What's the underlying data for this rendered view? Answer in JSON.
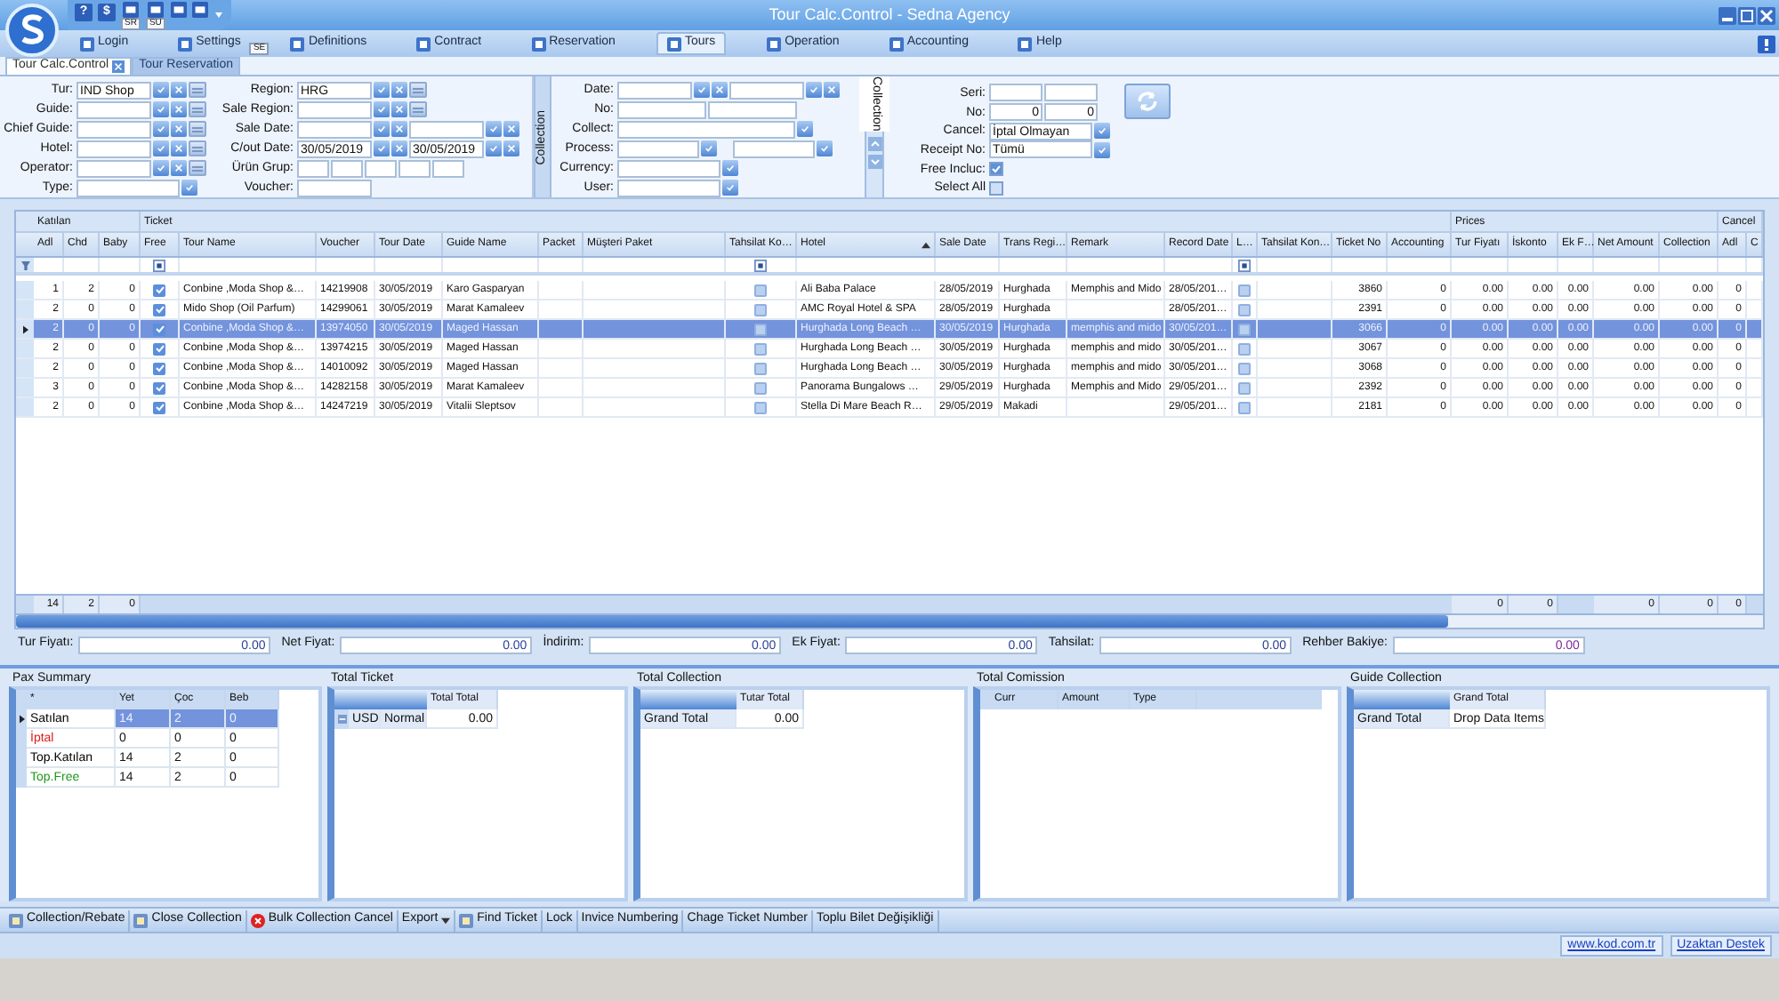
{
  "window": {
    "title": "Tour Calc.Control - Sedna Agency"
  },
  "quick_access": [
    {
      "kind": "glyph",
      "glyph": "?"
    },
    {
      "kind": "glyph",
      "glyph": "$"
    },
    {
      "kind": "icon",
      "badge": "SR"
    },
    {
      "kind": "icon",
      "badge": "SU"
    },
    {
      "kind": "icon"
    },
    {
      "kind": "icon"
    }
  ],
  "menu": [
    {
      "label": "Login",
      "selected": false
    },
    {
      "label": "Settings",
      "selected": false,
      "badge": "SE"
    },
    {
      "label": "Definitions",
      "selected": false
    },
    {
      "label": "Contract",
      "selected": false
    },
    {
      "label": "Reservation",
      "selected": false
    },
    {
      "label": "Tours",
      "selected": true
    },
    {
      "label": "Operation",
      "selected": false
    },
    {
      "label": "Accounting",
      "selected": false
    },
    {
      "label": "Help",
      "selected": false
    }
  ],
  "tabs": [
    {
      "label": "Tour Calc.Control",
      "selected": true
    },
    {
      "label": "Tour Reservation",
      "selected": false
    }
  ],
  "filters": {
    "left": [
      {
        "label": "Tur:",
        "kind": "lookup",
        "value": "IND Shop"
      },
      {
        "label": "Guide:",
        "kind": "lookup"
      },
      {
        "label": "Chief Guide:",
        "kind": "lookup"
      },
      {
        "label": "Hotel:",
        "kind": "lookup"
      },
      {
        "label": "Operator:",
        "kind": "lookup"
      },
      {
        "label": "Type:",
        "kind": "combo"
      }
    ],
    "middle": [
      {
        "label": "Region:",
        "kind": "lookup",
        "value": "HRG"
      },
      {
        "label": "Sale Region:",
        "kind": "lookup"
      },
      {
        "label": "Sale Date:",
        "kind": "date_range"
      },
      {
        "label": "C/out Date:",
        "kind": "date_range",
        "values": [
          "30/05/2019",
          "30/05/2019"
        ]
      },
      {
        "label": "Ürün Grup:",
        "kind": "boxes"
      },
      {
        "label": "Voucher:",
        "kind": "text"
      }
    ],
    "collection_tab": "Collection",
    "collection": [
      {
        "label": "Date:",
        "kind": "date_range"
      },
      {
        "label": "No:",
        "kind": "pair"
      },
      {
        "label": "Collect:",
        "kind": "combo_wide"
      },
      {
        "label": "Process:",
        "kind": "combo_pair"
      },
      {
        "label": "Currency:",
        "kind": "combo"
      },
      {
        "label": "User:",
        "kind": "combo"
      }
    ],
    "side_tab": "Collection",
    "receipt": [
      {
        "label": "Seri:",
        "kind": "pair_small"
      },
      {
        "label": "No:",
        "kind": "pair_small",
        "values": [
          "0",
          "0"
        ]
      },
      {
        "label": "Cancel:",
        "kind": "combo",
        "value": "İptal Olmayan"
      },
      {
        "label": "Receipt No:",
        "kind": "combo",
        "value": "Tümü"
      },
      {
        "label": "Free Incluc:",
        "kind": "check",
        "checked": true
      },
      {
        "label": "Select All",
        "kind": "check",
        "checked": false
      }
    ]
  },
  "grid": {
    "bands": [
      {
        "label": "Katılan"
      },
      {
        "label": "Ticket"
      },
      {
        "label": "Prices"
      },
      {
        "label": "Cancel"
      }
    ],
    "columns": [
      {
        "label": "Adl",
        "kind": "num"
      },
      {
        "label": "Chd",
        "kind": "num"
      },
      {
        "label": "Baby",
        "kind": "num"
      },
      {
        "label": "Free",
        "kind": "check"
      },
      {
        "label": "Tour Name",
        "kind": "text"
      },
      {
        "label": "Voucher",
        "kind": "text"
      },
      {
        "label": "Tour Date",
        "kind": "text"
      },
      {
        "label": "Guide Name",
        "kind": "text"
      },
      {
        "label": "Packet",
        "kind": "text"
      },
      {
        "label": "Müşteri Paket",
        "kind": "text"
      },
      {
        "label": "Tahsilat Ko…",
        "kind": "check"
      },
      {
        "label": "Hotel",
        "kind": "text",
        "sorted": true
      },
      {
        "label": "Sale Date",
        "kind": "text"
      },
      {
        "label": "Trans Regi…",
        "kind": "text"
      },
      {
        "label": "Remark",
        "kind": "text"
      },
      {
        "label": "Record Date",
        "kind": "text"
      },
      {
        "label": "L…",
        "kind": "check"
      },
      {
        "label": "Tahsilat Kon…",
        "kind": "text"
      },
      {
        "label": "Ticket No",
        "kind": "num"
      },
      {
        "label": "Accounting",
        "kind": "num"
      },
      {
        "label": "Tur Fiyatı",
        "kind": "num"
      },
      {
        "label": "İskonto",
        "kind": "num"
      },
      {
        "label": "Ek F…",
        "kind": "num"
      },
      {
        "label": "Net Amount",
        "kind": "num"
      },
      {
        "label": "Collection",
        "kind": "num"
      },
      {
        "label": "Adl",
        "kind": "num"
      },
      {
        "label": "C",
        "kind": "num"
      }
    ],
    "rows": [
      {
        "selected": false,
        "adl": "1",
        "chd": "2",
        "baby": "0",
        "free": true,
        "tour_name": "Conbine ,Moda Shop &…",
        "voucher": "14219908",
        "tour_date": "30/05/2019",
        "guide_name": "Karo Gasparyan",
        "tahsilat": false,
        "hotel": "Ali Baba Palace",
        "sale_date": "28/05/2019",
        "trans_region": "Hurghada",
        "remark": "Memphis and Mido",
        "record_date": "28/05/201…",
        "l": false,
        "ticket_no": "3860",
        "accounting": "0",
        "tur_fiyati": "0.00",
        "iskonto": "0.00",
        "ek_fiyat": "0.00",
        "net_amount": "0.00",
        "collection": "0.00",
        "cancel_adl": "0"
      },
      {
        "selected": false,
        "adl": "2",
        "chd": "0",
        "baby": "0",
        "free": true,
        "tour_name": "Mido Shop (Oil Parfum)",
        "voucher": "14299061",
        "tour_date": "30/05/2019",
        "guide_name": "Marat Kamaleev",
        "tahsilat": false,
        "hotel": "AMC Royal Hotel & SPA",
        "sale_date": "28/05/2019",
        "trans_region": "Hurghada",
        "record_date": "28/05/201…",
        "l": false,
        "ticket_no": "2391",
        "accounting": "0",
        "tur_fiyati": "0.00",
        "iskonto": "0.00",
        "ek_fiyat": "0.00",
        "net_amount": "0.00",
        "collection": "0.00",
        "cancel_adl": "0"
      },
      {
        "selected": true,
        "adl": "2",
        "chd": "0",
        "baby": "0",
        "free": true,
        "tour_name": "Conbine ,Moda Shop &…",
        "voucher": "13974050",
        "tour_date": "30/05/2019",
        "guide_name": "Maged Hassan",
        "tahsilat": false,
        "hotel": "Hurghada Long Beach …",
        "sale_date": "30/05/2019",
        "trans_region": "Hurghada",
        "remark": "memphis and mido",
        "record_date": "30/05/201…",
        "l": false,
        "ticket_no": "3066",
        "accounting": "0",
        "tur_fiyati": "0.00",
        "iskonto": "0.00",
        "ek_fiyat": "0.00",
        "net_amount": "0.00",
        "collection": "0.00",
        "cancel_adl": "0"
      },
      {
        "selected": false,
        "adl": "2",
        "chd": "0",
        "baby": "0",
        "free": true,
        "tour_name": "Conbine ,Moda Shop &…",
        "voucher": "13974215",
        "tour_date": "30/05/2019",
        "guide_name": "Maged Hassan",
        "tahsilat": false,
        "hotel": "Hurghada Long Beach …",
        "sale_date": "30/05/2019",
        "trans_region": "Hurghada",
        "remark": "memphis and mido",
        "record_date": "30/05/201…",
        "l": false,
        "ticket_no": "3067",
        "accounting": "0",
        "tur_fiyati": "0.00",
        "iskonto": "0.00",
        "ek_fiyat": "0.00",
        "net_amount": "0.00",
        "collection": "0.00",
        "cancel_adl": "0"
      },
      {
        "selected": false,
        "adl": "2",
        "chd": "0",
        "baby": "0",
        "free": true,
        "tour_name": "Conbine ,Moda Shop &…",
        "voucher": "14010092",
        "tour_date": "30/05/2019",
        "guide_name": "Maged Hassan",
        "tahsilat": false,
        "hotel": "Hurghada Long Beach …",
        "sale_date": "30/05/2019",
        "trans_region": "Hurghada",
        "remark": "memphis and mido",
        "record_date": "30/05/201…",
        "l": false,
        "ticket_no": "3068",
        "accounting": "0",
        "tur_fiyati": "0.00",
        "iskonto": "0.00",
        "ek_fiyat": "0.00",
        "net_amount": "0.00",
        "collection": "0.00",
        "cancel_adl": "0"
      },
      {
        "selected": false,
        "adl": "3",
        "chd": "0",
        "baby": "0",
        "free": true,
        "tour_name": "Conbine ,Moda Shop &…",
        "voucher": "14282158",
        "tour_date": "30/05/2019",
        "guide_name": "Marat Kamaleev",
        "tahsilat": false,
        "hotel": "Panorama Bungalows …",
        "sale_date": "29/05/2019",
        "trans_region": "Hurghada",
        "remark": "Memphis and Mido",
        "record_date": "29/05/201…",
        "l": false,
        "ticket_no": "2392",
        "accounting": "0",
        "tur_fiyati": "0.00",
        "iskonto": "0.00",
        "ek_fiyat": "0.00",
        "net_amount": "0.00",
        "collection": "0.00",
        "cancel_adl": "0"
      },
      {
        "selected": false,
        "adl": "2",
        "chd": "0",
        "baby": "0",
        "free": true,
        "tour_name": "Conbine ,Moda Shop &…",
        "voucher": "14247219",
        "tour_date": "30/05/2019",
        "guide_name": "Vitalii Sleptsov",
        "tahsilat": false,
        "hotel": "Stella Di Mare Beach R…",
        "sale_date": "29/05/2019",
        "trans_region": "Makadi",
        "record_date": "29/05/201…",
        "l": false,
        "ticket_no": "2181",
        "accounting": "0",
        "tur_fiyati": "0.00",
        "iskonto": "0.00",
        "ek_fiyat": "0.00",
        "net_amount": "0.00",
        "collection": "0.00",
        "cancel_adl": "0"
      }
    ],
    "footer": {
      "adl": "14",
      "chd": "2",
      "baby": "0",
      "tur_fiyati": "0",
      "iskonto": "0",
      "net_amount": "0",
      "collection": "0",
      "cancel_adl": "0"
    }
  },
  "summary": [
    {
      "label": "Tur Fiyatı:",
      "value": "0.00",
      "color": "#2b3f95"
    },
    {
      "label": "Net Fiyat:",
      "value": "0.00",
      "color": "#2b3f95"
    },
    {
      "label": "İndirim:",
      "value": "0.00",
      "color": "#2b3f95"
    },
    {
      "label": "Ek Fiyat:",
      "value": "0.00",
      "color": "#2b3f95"
    },
    {
      "label": "Tahsilat:",
      "value": "0.00",
      "color": "#2b3f95"
    },
    {
      "label": "Rehber Bakiye:",
      "value": "0.00",
      "color": "#7b2c9c"
    }
  ],
  "pax_summary": {
    "title": "Pax Summary",
    "columns": [
      "*",
      "Yet",
      "Çoc",
      "Beb"
    ],
    "rows": [
      {
        "label": "Satılan",
        "color": "#000000",
        "selected": true,
        "values": [
          "14",
          "2",
          "0"
        ]
      },
      {
        "label": "İptal",
        "color": "#e01b1b",
        "selected": false,
        "values": [
          "0",
          "0",
          "0"
        ]
      },
      {
        "label": "Top.Katılan",
        "color": "#000000",
        "selected": false,
        "values": [
          "14",
          "2",
          "0"
        ]
      },
      {
        "label": "Top.Free",
        "color": "#1e9a1e",
        "selected": false,
        "values": [
          "14",
          "2",
          "0"
        ]
      }
    ]
  },
  "total_ticket": {
    "title": "Total Ticket",
    "header": "Total Total",
    "row": [
      "USD",
      "Normal",
      "0.00"
    ]
  },
  "total_collection": {
    "title": "Total Collection",
    "header": "Tutar Total",
    "row": [
      "Grand Total",
      "0.00"
    ]
  },
  "total_comission": {
    "title": "Total Comission",
    "columns": [
      "Curr",
      "Amount",
      "Type"
    ]
  },
  "guide_collection": {
    "title": "Guide Collection",
    "header": "Grand Total",
    "row": [
      "Grand Total",
      "Drop Data Items"
    ]
  },
  "toolbar": [
    {
      "label": "Collection/Rebate",
      "kind": "icon"
    },
    {
      "label": "Close Collection",
      "kind": "icon"
    },
    {
      "label": "Bulk Collection Cancel",
      "kind": "cancel"
    },
    {
      "label": "Export",
      "kind": "menu"
    },
    {
      "label": "Find Ticket",
      "kind": "icon"
    },
    {
      "label": "Lock",
      "kind": "plain"
    },
    {
      "label": "Invice Numbering",
      "kind": "plain"
    },
    {
      "label": "Chage Ticket Number",
      "kind": "plain"
    },
    {
      "label": "Toplu Bilet Değişikliği",
      "kind": "plain"
    }
  ],
  "status_links": [
    "www.kod.com.tr",
    "Uzaktan Destek"
  ]
}
